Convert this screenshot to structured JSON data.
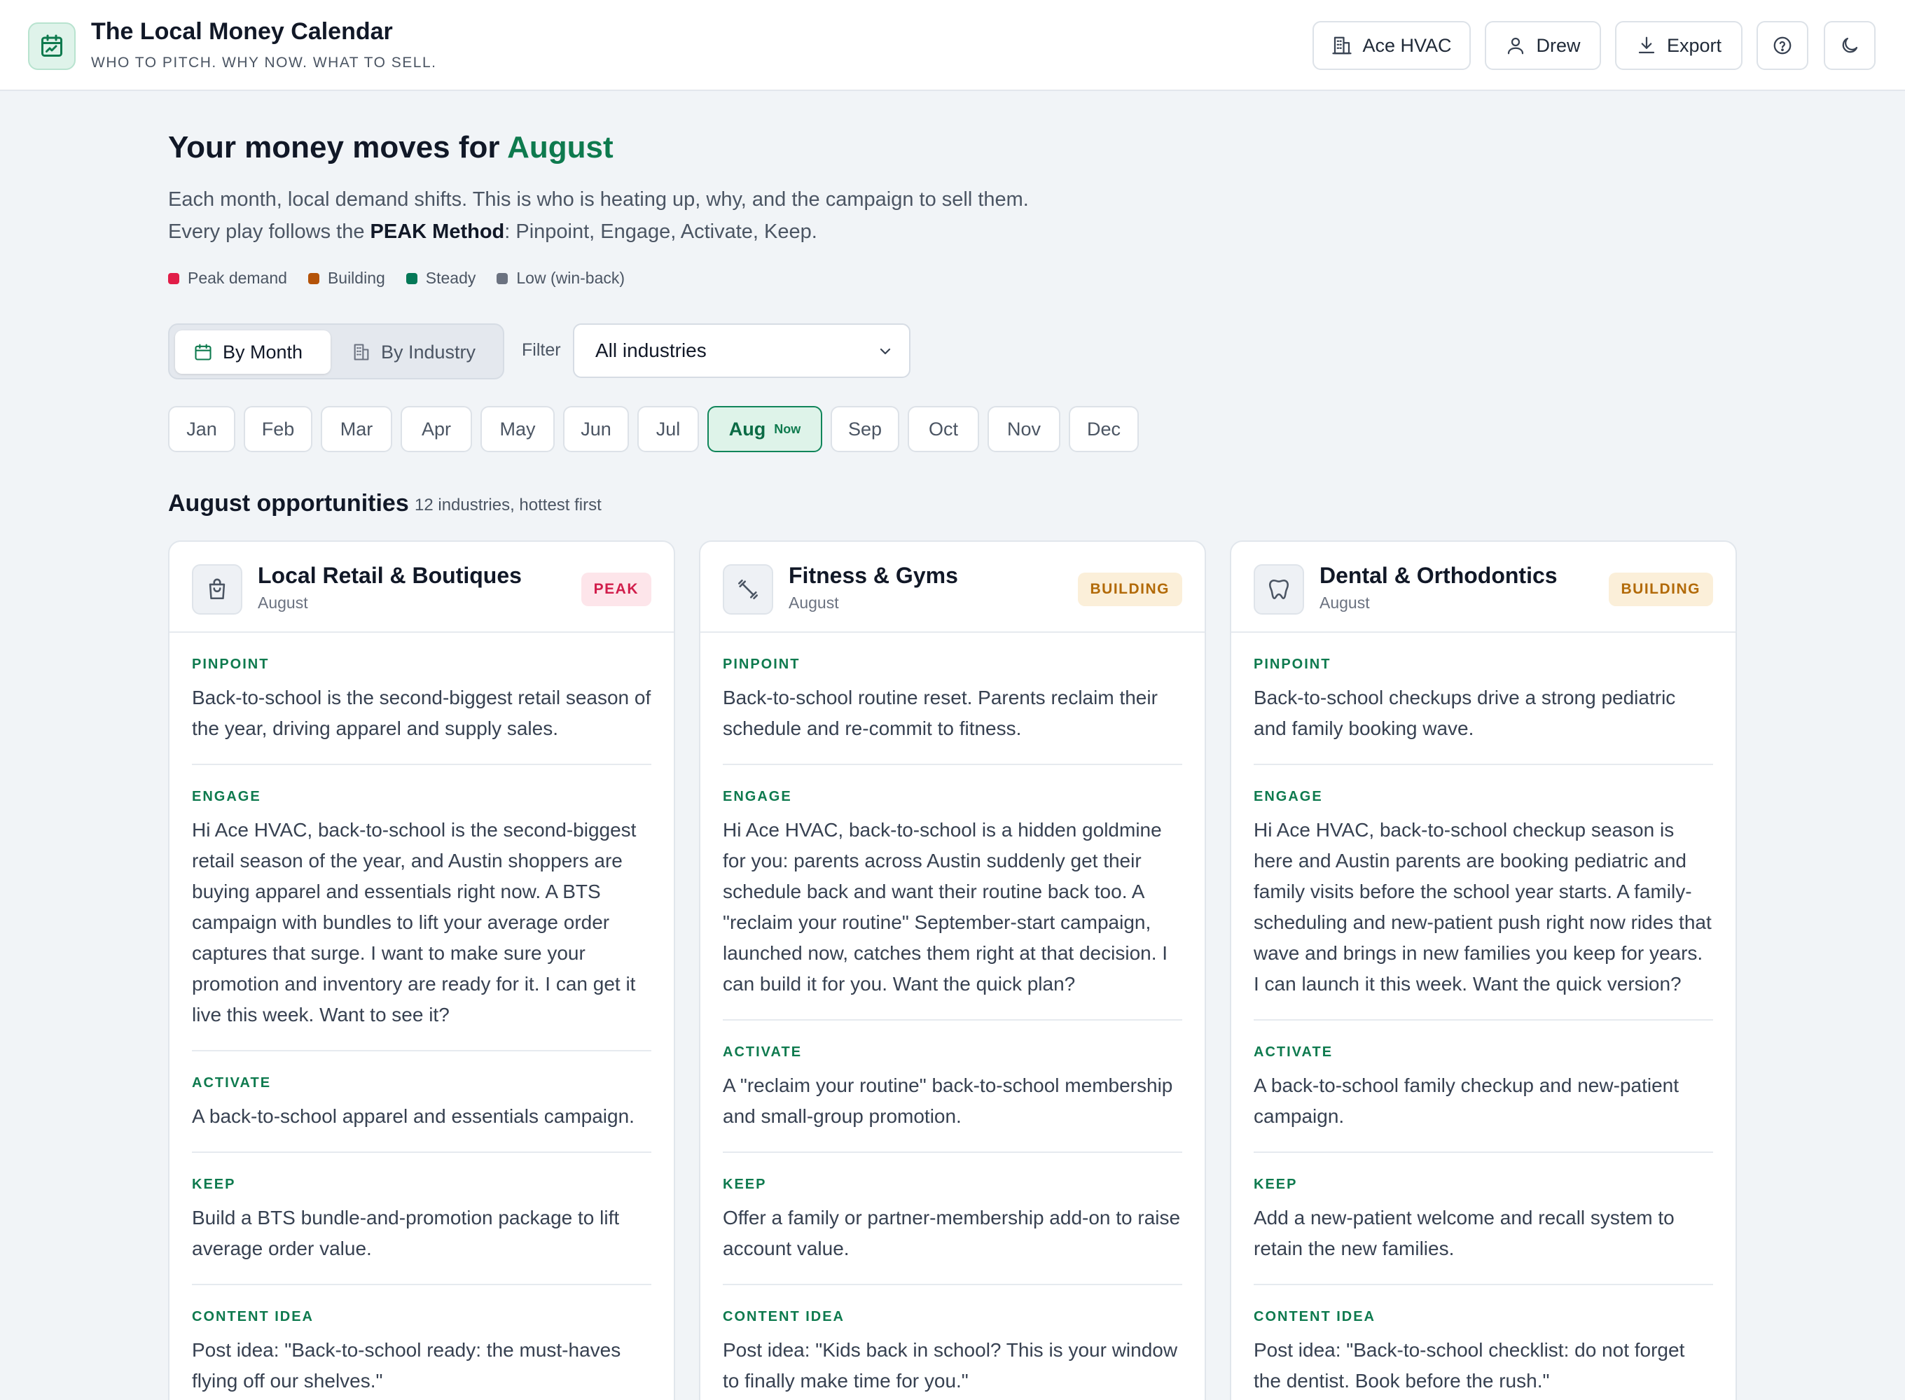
{
  "app": {
    "title": "The Local Money Calendar",
    "subtitle": "WHO TO PITCH. WHY NOW. WHAT TO SELL."
  },
  "header": {
    "business_label": "Ace HVAC",
    "user_label": "Drew",
    "export_label": "Export",
    "icons": [
      "calendar-chart-icon",
      "building-icon",
      "user-icon",
      "download-icon",
      "help-circle-icon",
      "moon-icon"
    ]
  },
  "main": {
    "heading_prefix": "Your money moves for",
    "heading_month": "August",
    "desc_line1": "Each month, local demand shifts. This is who is heating up, why, and the campaign to sell them.",
    "desc_line2_prefix": "Every play follows the",
    "desc_line2_method": "PEAK Method",
    "desc_line2_suffix": ": Pinpoint, Engage, Activate, Keep."
  },
  "legend": [
    {
      "label": "Peak demand",
      "color": "#e11d48"
    },
    {
      "label": "Building",
      "color": "#b45309"
    },
    {
      "label": "Steady",
      "color": "#047857"
    },
    {
      "label": "Low (win-back)",
      "color": "#6b7280"
    }
  ],
  "view_toggle": {
    "by_month": "By Month",
    "by_industry": "By Industry",
    "active": "By Month"
  },
  "filter": {
    "label": "Filter",
    "selected": "All industries"
  },
  "months": {
    "items": [
      "Jan",
      "Feb",
      "Mar",
      "Apr",
      "May",
      "Jun",
      "Jul",
      "Aug",
      "Sep",
      "Oct",
      "Nov",
      "Dec"
    ],
    "active": "Aug",
    "now_badge": "Now"
  },
  "section": {
    "title": "August opportunities",
    "subtitle": "12 industries, hottest first"
  },
  "labels": {
    "pinpoint": "PINPOINT",
    "engage": "ENGAGE",
    "activate": "ACTIVATE",
    "keep": "KEEP",
    "content_idea": "CONTENT IDEA"
  },
  "cards": [
    {
      "title": "Local Retail & Boutiques",
      "month": "August",
      "badge": "PEAK",
      "icon": "shopping-bag-icon",
      "pinpoint": "Back-to-school is the second-biggest retail season of the year, driving apparel and supply sales.",
      "engage": "Hi Ace HVAC, back-to-school is the second-biggest retail season of the year, and Austin shoppers are buying apparel and essentials right now. A BTS campaign with bundles to lift your average order captures that surge. I want to make sure your promotion and inventory are ready for it. I can get it live this week. Want to see it?",
      "activate": "A back-to-school apparel and essentials campaign.",
      "keep": "Build a BTS bundle-and-promotion package to lift average order value.",
      "content_idea": "Post idea: \"Back-to-school ready: the must-haves flying off our shelves.\""
    },
    {
      "title": "Fitness & Gyms",
      "month": "August",
      "badge": "BUILDING",
      "icon": "dumbbell-icon",
      "pinpoint": "Back-to-school routine reset. Parents reclaim their schedule and re-commit to fitness.",
      "engage": "Hi Ace HVAC, back-to-school is a hidden goldmine for you: parents across Austin suddenly get their schedule back and want their routine back too. A \"reclaim your routine\" September-start campaign, launched now, catches them right at that decision. I can build it for you. Want the quick plan?",
      "activate": "A \"reclaim your routine\" back-to-school membership and small-group promotion.",
      "keep": "Offer a family or partner-membership add-on to raise account value.",
      "content_idea": "Post idea: \"Kids back in school? This is your window to finally make time for you.\""
    },
    {
      "title": "Dental & Orthodontics",
      "month": "August",
      "badge": "BUILDING",
      "icon": "tooth-icon",
      "pinpoint": "Back-to-school checkups drive a strong pediatric and family booking wave.",
      "engage": "Hi Ace HVAC, back-to-school checkup season is here and Austin parents are booking pediatric and family visits before the school year starts. A family-scheduling and new-patient push right now rides that wave and brings in new families you keep for years. I can launch it this week. Want the quick version?",
      "activate": "A back-to-school family checkup and new-patient campaign.",
      "keep": "Add a new-patient welcome and recall system to retain the new families.",
      "content_idea": "Post idea: \"Back-to-school checklist: do not forget the dentist. Book before the rush.\""
    }
  ]
}
